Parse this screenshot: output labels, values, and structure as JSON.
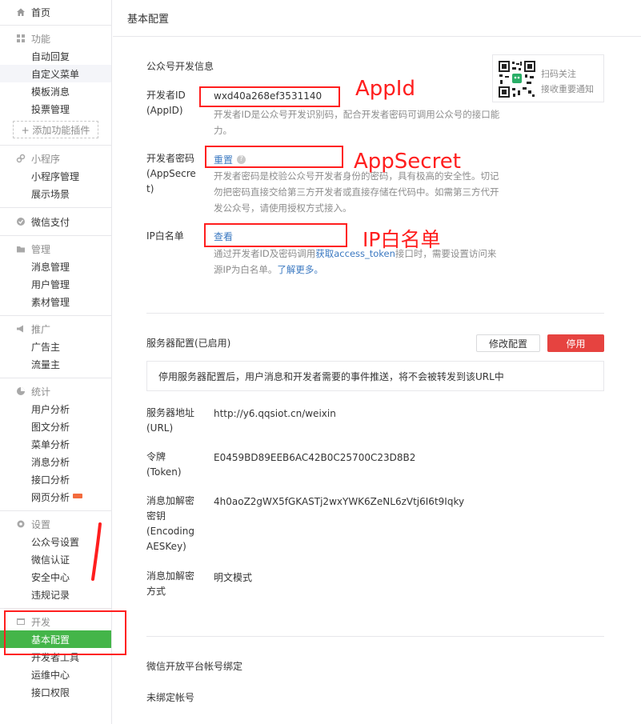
{
  "sidebar": {
    "home": "首页",
    "sections": [
      {
        "title": "功能",
        "icon": "grid-icon",
        "items": [
          "自动回复",
          "自定义菜单",
          "模板消息",
          "投票管理"
        ],
        "add": "+ 添加功能插件"
      },
      {
        "title": "小程序",
        "icon": "link-icon",
        "items": [
          "小程序管理",
          "展示场景"
        ]
      },
      {
        "title": "微信支付",
        "icon": "pay-icon",
        "items": []
      },
      {
        "title": "管理",
        "icon": "folder-icon",
        "items": [
          "消息管理",
          "用户管理",
          "素材管理"
        ]
      },
      {
        "title": "推广",
        "icon": "megaphone-icon",
        "items": [
          "广告主",
          "流量主"
        ]
      },
      {
        "title": "统计",
        "icon": "pie-icon",
        "items": [
          "用户分析",
          "图文分析",
          "菜单分析",
          "消息分析",
          "接口分析",
          "网页分析"
        ]
      },
      {
        "title": "设置",
        "icon": "gear-icon",
        "items": [
          "公众号设置",
          "微信认证",
          "安全中心",
          "违规记录"
        ]
      },
      {
        "title": "开发",
        "icon": "dev-icon",
        "items": [
          "基本配置",
          "开发者工具",
          "运维中心",
          "接口权限"
        ]
      }
    ]
  },
  "header": {
    "title": "基本配置"
  },
  "dev_info": {
    "title": "公众号开发信息",
    "qr_text_1": "扫码关注",
    "qr_text_2": "接收重要通知",
    "appid_label_1": "开发者ID",
    "appid_label_2": "(AppID)",
    "appid_value": "wxd40a268ef3531140",
    "appid_desc_1": "开发者ID是公众号开发识别码，配合开发者密码可调用公众号的接口能",
    "appid_desc_2": "力。",
    "secret_label_1": "开发者密码",
    "secret_label_2": "(AppSecre",
    "secret_label_3": "t)",
    "secret_link": "重置",
    "secret_desc_1": "开发者密码是校验公众号开发者身份的密码，具有极高的安全性。切记",
    "secret_desc_2": "勿把密码直接交给第三方开发者或直接存储在代码中。如需第三方代开",
    "secret_desc_3": "发公众号，请使用授权方式接入。",
    "ip_label": "IP白名单",
    "ip_link": "查看",
    "ip_desc_1a": "通过开发者ID及密码调用",
    "ip_desc_1b": "获取access_token",
    "ip_desc_1c": "接口时，需要设置访问来",
    "ip_desc_2a": "源IP为白名单。",
    "ip_desc_2b": "了解更多。"
  },
  "server": {
    "title": "服务器配置(已启用)",
    "modify_btn": "修改配置",
    "stop_btn": "停用",
    "tip": "停用服务器配置后，用户消息和开发者需要的事件推送，将不会被转发到该URL中",
    "url_label_1": "服务器地址",
    "url_label_2": "(URL)",
    "url_value": "http://y6.qqsiot.cn/weixin",
    "token_label_1": "令牌",
    "token_label_2": "(Token)",
    "token_value": "E0459BD89EEB6AC42B0C25700C23D8B2",
    "aes_label_1": "消息加解密",
    "aes_label_2": "密钥",
    "aes_label_3": "(Encoding",
    "aes_label_4": "AESKey)",
    "aes_value": "4h0aoZ2gWX5fGKASTj2wxYWK6ZeNL6zVtj6I6t9Iqky",
    "mode_label_1": "消息加解密",
    "mode_label_2": "方式",
    "mode_value": "明文模式"
  },
  "open_platform": {
    "title": "微信开放平台帐号绑定",
    "status": "未绑定帐号"
  },
  "annotations": {
    "appid": "AppId",
    "appsecret": "AppSecret",
    "ip": "IP白名单",
    "color": "#ff1e1e"
  },
  "colors": {
    "accent": "#44b549",
    "danger": "#e64340",
    "link": "#3a78c1"
  }
}
